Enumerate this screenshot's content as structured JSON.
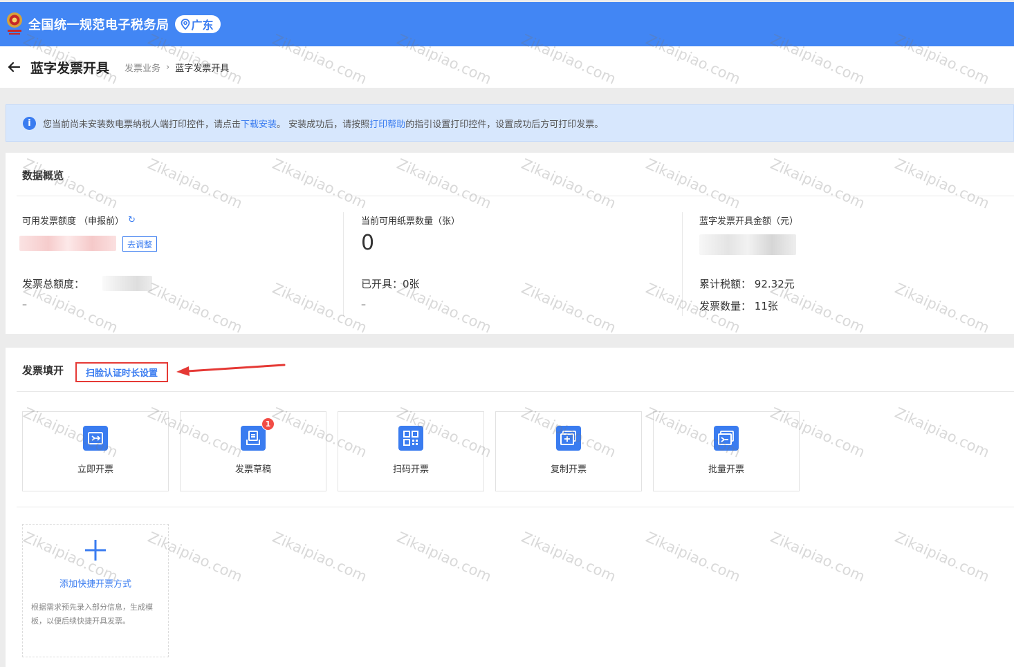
{
  "header": {
    "site_title": "全国统一规范电子税务局",
    "region": "广东"
  },
  "subheader": {
    "page_title": "蓝字发票开具",
    "breadcrumb": [
      "发票业务",
      "蓝字发票开具"
    ]
  },
  "notice": {
    "text_1": "您当前尚未安装数电票纳税人端打印控件，请点击",
    "link_1": "下载安装",
    "text_2": "。 安装成功后，请按照",
    "link_2": "打印帮助",
    "text_3": "的指引设置打印控件，设置成功后方可打印发票。"
  },
  "overview": {
    "title": "数据概览",
    "quota": {
      "label": "可用发票额度 （申报前）",
      "adjust_label": "去调整",
      "total_label": "发票总额度：",
      "dash": "–"
    },
    "paper": {
      "label": "当前可用纸票数量（张）",
      "value": "0",
      "issued_label": "已开具：",
      "issued_value": "0张",
      "dash": "–"
    },
    "amount": {
      "label": "蓝字发票开具金额（元）",
      "tax_label": "累计税额：",
      "tax_value": "92.32元",
      "count_label": "发票数量：",
      "count_value": "11张"
    }
  },
  "issuing": {
    "title": "发票填开",
    "face_setting": "扫脸认证时长设置",
    "cards": [
      {
        "label": "立即开票",
        "icon": "invoice-issue-icon"
      },
      {
        "label": "发票草稿",
        "icon": "draft-icon",
        "badge": "1"
      },
      {
        "label": "扫码开票",
        "icon": "qr-code-icon"
      },
      {
        "label": "复制开票",
        "icon": "copy-invoice-icon"
      },
      {
        "label": "批量开票",
        "icon": "batch-invoice-icon"
      }
    ],
    "add_shortcut": {
      "title": "添加快捷开票方式",
      "desc": "根据需求预先录入部分信息，生成模板，以便后续快捷开具发票。"
    }
  },
  "watermark": "Zikaipiao.com",
  "colors": {
    "brand_blue": "#4286f4",
    "link_blue": "#3a7cf0",
    "highlight_red": "#e53935",
    "badge_red": "#f24c45"
  }
}
